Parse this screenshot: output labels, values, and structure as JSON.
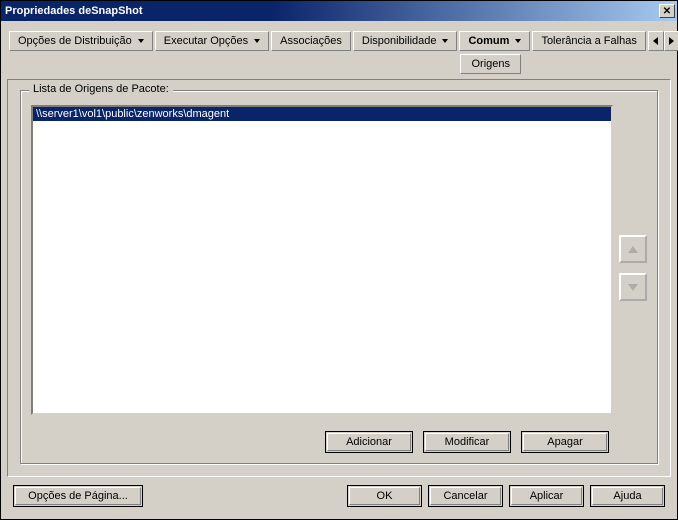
{
  "window": {
    "title": "Propriedades deSnapShot"
  },
  "tabs": {
    "distrib": "Opções de Distribuição",
    "exec": "Executar Opções",
    "assoc": "Associações",
    "dispon": "Disponibilidade",
    "comum": "Comum",
    "comum_sub": "Origens",
    "toler": "Tolerância a Falhas"
  },
  "group": {
    "label": "Lista de Origens de Pacote:"
  },
  "list": {
    "items": [
      "\\\\server1\\vol1\\public\\zenworks\\dmagent"
    ]
  },
  "buttons": {
    "add": "Adicionar",
    "mod": "Modificar",
    "del": "Apagar",
    "pageopts": "Opções de Página...",
    "ok": "OK",
    "cancel": "Cancelar",
    "apply": "Aplicar",
    "help": "Ajuda"
  }
}
